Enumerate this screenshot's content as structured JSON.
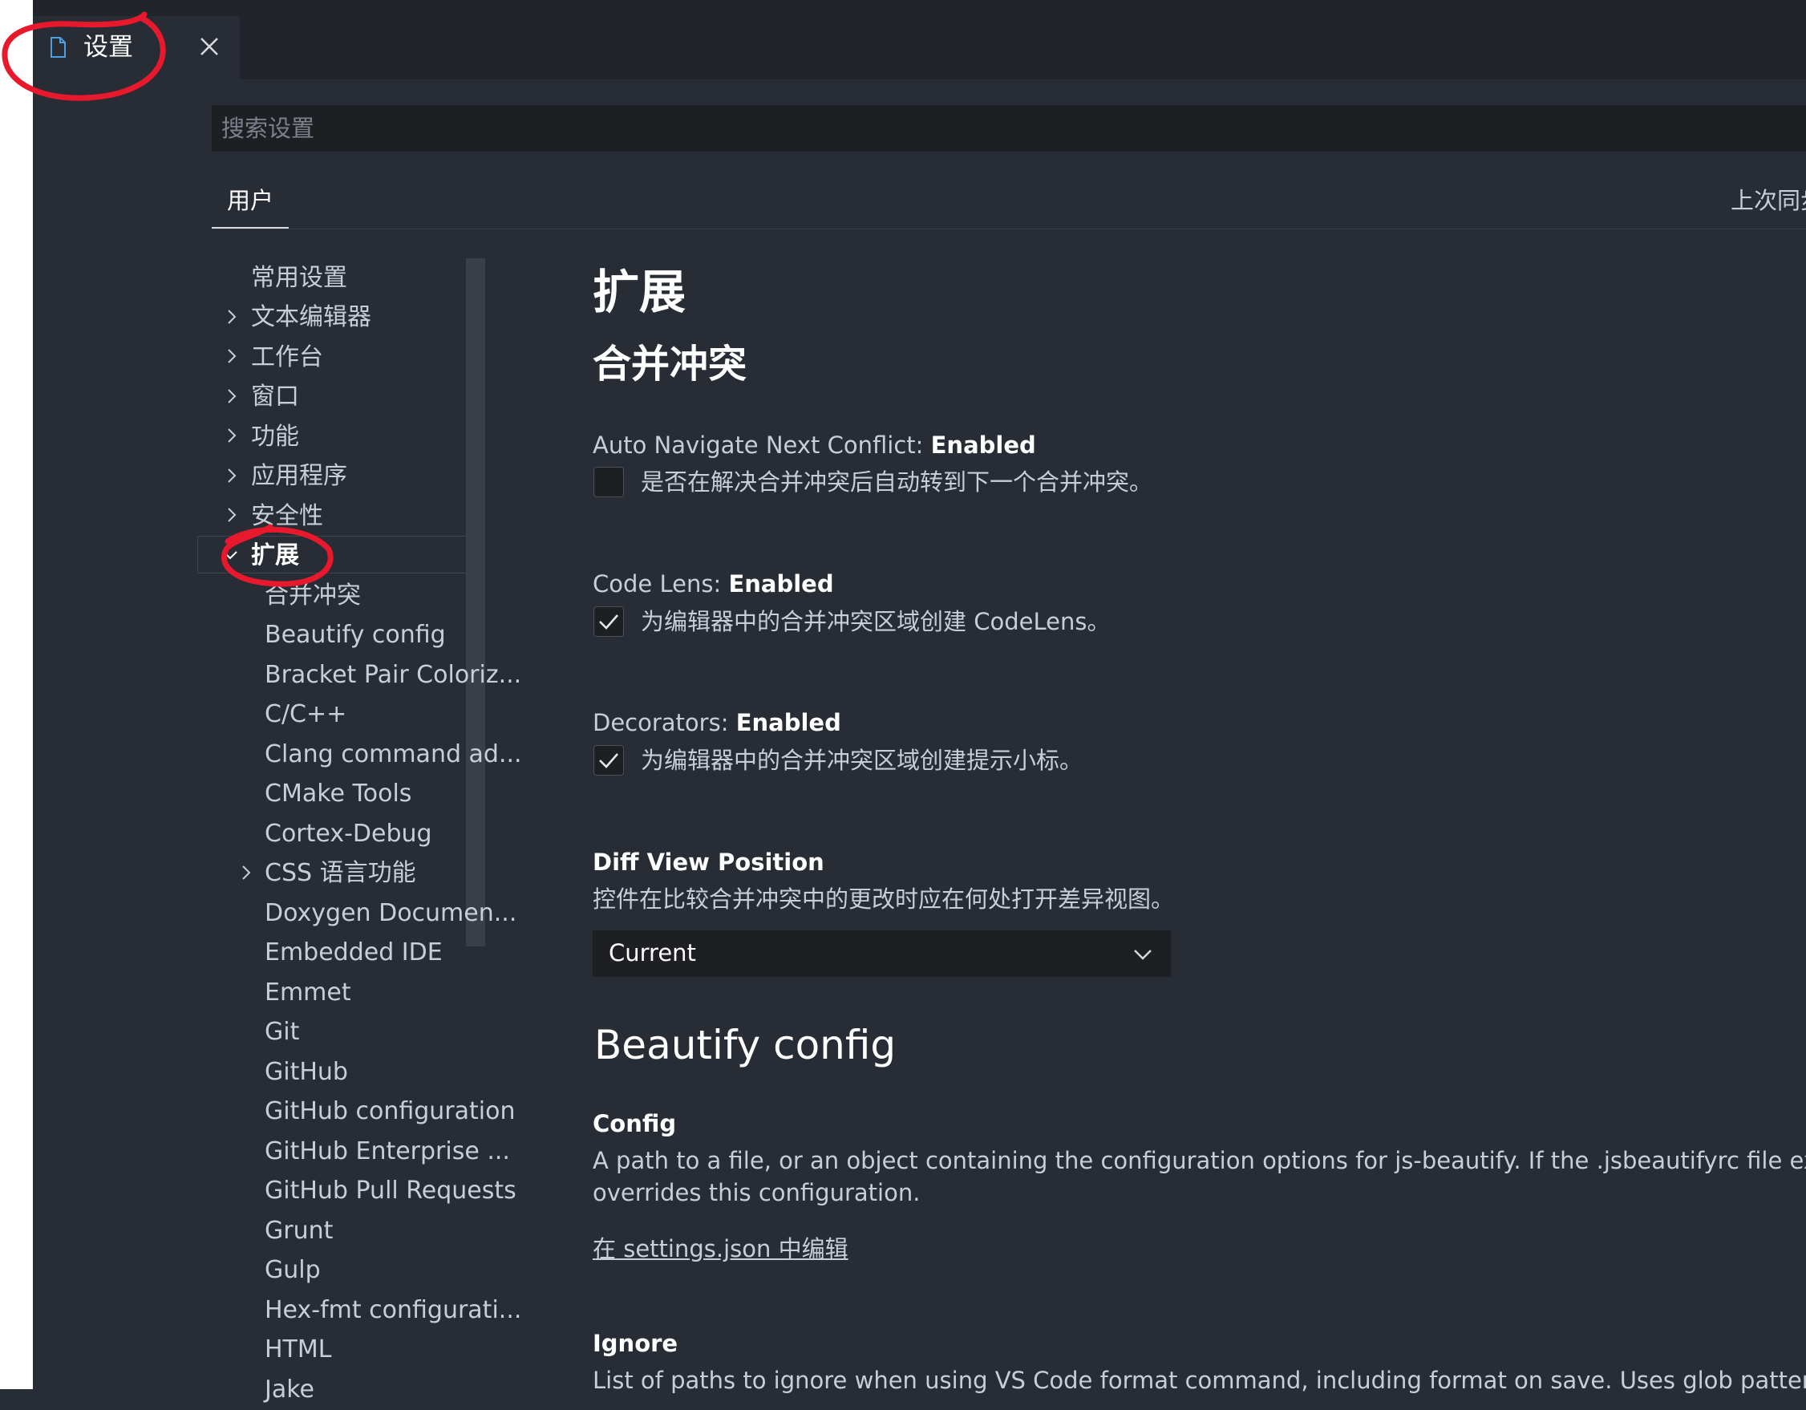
{
  "tab": {
    "title": "设置",
    "file_icon": "file-icon",
    "close_icon": "close-icon"
  },
  "search": {
    "placeholder": "搜索设置"
  },
  "scope": {
    "user_tab": "用户",
    "sync_status": "上次同步"
  },
  "toc": {
    "items": [
      {
        "label": "常用设置"
      },
      {
        "label": "文本编辑器"
      },
      {
        "label": "工作台"
      },
      {
        "label": "窗口"
      },
      {
        "label": "功能"
      },
      {
        "label": "应用程序"
      },
      {
        "label": "安全性"
      },
      {
        "label": "扩展"
      },
      {
        "label": "合并冲突"
      },
      {
        "label": "Beautify config"
      },
      {
        "label": "Bracket Pair Coloriz..."
      },
      {
        "label": "C/C++"
      },
      {
        "label": "Clang command ad..."
      },
      {
        "label": "CMake Tools"
      },
      {
        "label": "Cortex-Debug"
      },
      {
        "label": "CSS 语言功能"
      },
      {
        "label": "Doxygen Documen..."
      },
      {
        "label": "Embedded IDE"
      },
      {
        "label": "Emmet"
      },
      {
        "label": "Git"
      },
      {
        "label": "GitHub"
      },
      {
        "label": "GitHub configuration"
      },
      {
        "label": "GitHub Enterprise ..."
      },
      {
        "label": "GitHub Pull Requests"
      },
      {
        "label": "Grunt"
      },
      {
        "label": "Gulp"
      },
      {
        "label": "Hex-fmt configurati..."
      },
      {
        "label": "HTML"
      },
      {
        "label": "Jake"
      }
    ]
  },
  "main": {
    "section_title": "扩展",
    "subsection_title": "合并冲突",
    "settings": {
      "auto_navigate": {
        "prefix": "Auto Navigate Next Conflict: ",
        "name": "Enabled",
        "description": "是否在解决合并冲突后自动转到下一个合并冲突。",
        "checked": false
      },
      "code_lens": {
        "prefix": "Code Lens: ",
        "name": "Enabled",
        "description": "为编辑器中的合并冲突区域创建 CodeLens。",
        "checked": true
      },
      "decorators": {
        "prefix": "Decorators: ",
        "name": "Enabled",
        "description": "为编辑器中的合并冲突区域创建提示小标。",
        "checked": true
      },
      "diff_view": {
        "name": "Diff View Position",
        "description": "控件在比较合并冲突中的更改时应在何处打开差异视图。",
        "value": "Current"
      }
    },
    "beautify": {
      "title": "Beautify config",
      "config": {
        "name": "Config",
        "description_line1": "A path to a file, or an object containing the configuration options for js-beautify. If the .jsbeautifyrc file exists in project root, it",
        "description_line2": "overrides this configuration.",
        "edit_link": "在 settings.json 中编辑"
      },
      "ignore": {
        "name": "Ignore",
        "description": "List of paths to ignore when using VS Code format command, including format on save. Uses glob pattern matching."
      }
    }
  },
  "colors": {
    "background": "#282c34",
    "tabbar": "#21252b",
    "input": "#1d1f23",
    "annotation": "#e8192c"
  }
}
